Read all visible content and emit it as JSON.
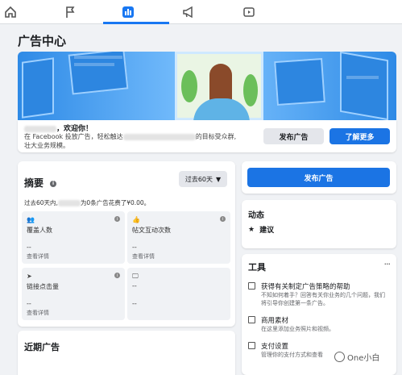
{
  "nav": {
    "icons": [
      "home-icon",
      "flag-icon",
      "insights-icon",
      "megaphone-icon",
      "video-icon"
    ],
    "active_index": 2,
    "accent": "#1877f2"
  },
  "page_title": "广告中心",
  "welcome": {
    "greeting": "，欢迎你！",
    "line1_prefix": "在 Facebook 投放广告，轻松触达",
    "line1_suffix": "的目标受众群,",
    "line2": "壮大业务规模。",
    "publish_button": "发布广告",
    "learn_more_button": "了解更多"
  },
  "summary": {
    "title": "摘要",
    "range_label": "过去60天",
    "period_prefix": "过去60天内,",
    "period_suffix": "为0条广告花费了¥0.00。",
    "metrics": [
      {
        "icon": "people-icon",
        "label": "覆盖人数",
        "value": "--",
        "link": "查看详情",
        "has_info": true
      },
      {
        "icon": "thumbs-up-icon",
        "label": "帖文互动次数",
        "value": "--",
        "link": "查看详情",
        "has_info": true
      },
      {
        "icon": "cursor-icon",
        "label": "链接点击量",
        "value": "--",
        "link": "查看详情",
        "has_info": true
      },
      {
        "icon": "monitor-icon",
        "label": "--",
        "value": "--",
        "link": "",
        "has_info": false
      }
    ]
  },
  "recent_ads": {
    "title": "近期广告"
  },
  "create": {
    "button": "发布广告"
  },
  "activity": {
    "title": "动态",
    "item": "建议"
  },
  "tools": {
    "title": "工具",
    "items": [
      {
        "icon": "help-doc-icon",
        "name": "获得有关制定广告策略的帮助",
        "desc": "不知如何着手？回答有关你业务的几个问题，我们将引导你创建第一条广告。"
      },
      {
        "icon": "media-icon",
        "name": "商用素材",
        "desc": "在这里添加业务照片和视频。"
      },
      {
        "icon": "card-icon",
        "name": "支付设置",
        "desc": "管理你的支付方式和查看"
      }
    ]
  },
  "watermark": "One小白",
  "colors": {
    "primary": "#1b74e4",
    "background": "#f0f2f5"
  }
}
